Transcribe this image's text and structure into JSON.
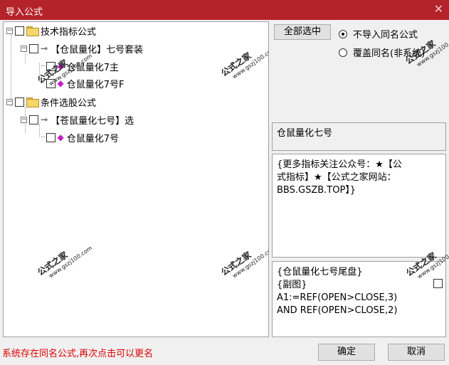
{
  "window": {
    "title": "导入公式"
  },
  "tree": {
    "n1": "技术指标公式",
    "n2": "【仓鼠量化】七号套装",
    "n3": "仓鼠量化7主",
    "n4": "仓鼠量化7号F",
    "n5": "条件选股公式",
    "n6": "【苍鼠量化七号】选",
    "n7": "仓鼠量化7号"
  },
  "buttons": {
    "select_all": "全部选中",
    "ok": "确定",
    "cancel": "取消"
  },
  "radios": {
    "skip_same": "不导入同名公式",
    "overwrite_same": "覆盖同名(非系统)"
  },
  "detail": {
    "name": "仓鼠量化七号",
    "description": "{更多指标关注公众号：★【公\n式指标】★【公式之家网站：\nBBS.GSZB.TOP】}",
    "code": "{仓鼠量化七号尾盘}\n{副图}\nA1:=REF(OPEN>CLOSE,3)\nAND REF(OPEN>CLOSE,2)"
  },
  "watermark": {
    "brand": "公式之家",
    "url": "www.gszj100.com"
  },
  "status": {
    "message": "系统存在同名公式,再次点击可以更名"
  }
}
